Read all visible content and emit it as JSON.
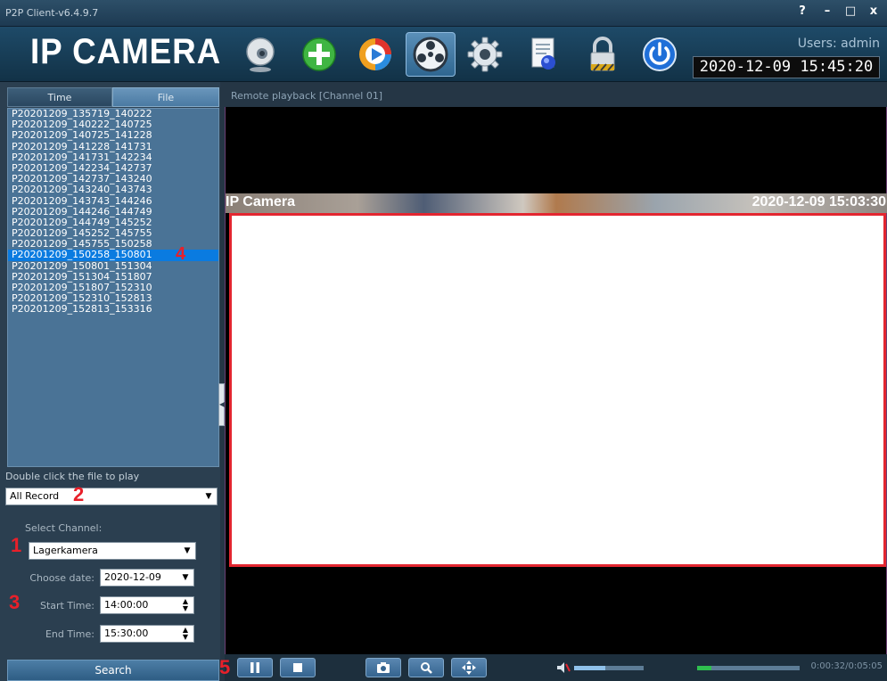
{
  "window": {
    "title": "P2P Client-v6.4.9.7",
    "controls": {
      "help": "?",
      "minimize": "–",
      "maximize": "□",
      "close": "x"
    }
  },
  "header": {
    "logo": "IP CAMERA",
    "users": "Users: admin",
    "clock": "2020-12-09  15:45:20",
    "toolbar": [
      {
        "name": "live-view",
        "icon": "webcam-icon"
      },
      {
        "name": "add-device",
        "icon": "plus-icon"
      },
      {
        "name": "media-play",
        "icon": "play-icon"
      },
      {
        "name": "remote-playback",
        "icon": "reel-icon",
        "active": true
      },
      {
        "name": "settings",
        "icon": "gear-icon"
      },
      {
        "name": "log",
        "icon": "document-icon"
      },
      {
        "name": "lock",
        "icon": "lock-icon"
      },
      {
        "name": "exit",
        "icon": "power-icon"
      }
    ]
  },
  "left": {
    "tabs": {
      "time": "Time",
      "file": "File"
    },
    "files": [
      "P20201209_135719_140222",
      "P20201209_140222_140725",
      "P20201209_140725_141228",
      "P20201209_141228_141731",
      "P20201209_141731_142234",
      "P20201209_142234_142737",
      "P20201209_142737_143240",
      "P20201209_143240_143743",
      "P20201209_143743_144246",
      "P20201209_144246_144749",
      "P20201209_144749_145252",
      "P20201209_145252_145755",
      "P20201209_145755_150258",
      "P20201209_150258_150801",
      "P20201209_150801_151304",
      "P20201209_151304_151807",
      "P20201209_151807_152310",
      "P20201209_152310_152813",
      "P20201209_152813_153316"
    ],
    "selected_index": 13,
    "hint": "Double click the file to play",
    "record_type": "All Record",
    "select_channel_label": "Select Channel:",
    "channel": "Lagerkamera",
    "choose_date_label": "Choose date:",
    "date": "2020-12-09",
    "start_time_label": "Start Time:",
    "start_time": "14:00:00",
    "end_time_label": "End Time:",
    "end_time": "15:30:00",
    "search_label": "Search"
  },
  "playback": {
    "title": "Remote playback [Channel 01]",
    "osd_name": "IP Camera",
    "osd_time": "2020-12-09 15:03:30",
    "time_counter": "0:00:32/0:05:05",
    "volume_level": 0.45,
    "progress_level": 0.14
  },
  "markers": {
    "m1": "1",
    "m2": "2",
    "m3": "3",
    "m4": "4",
    "m5": "5"
  },
  "colors": {
    "accent": "#0a7be0",
    "marker": "#e8202a",
    "highlight_frame": "#e32630"
  }
}
